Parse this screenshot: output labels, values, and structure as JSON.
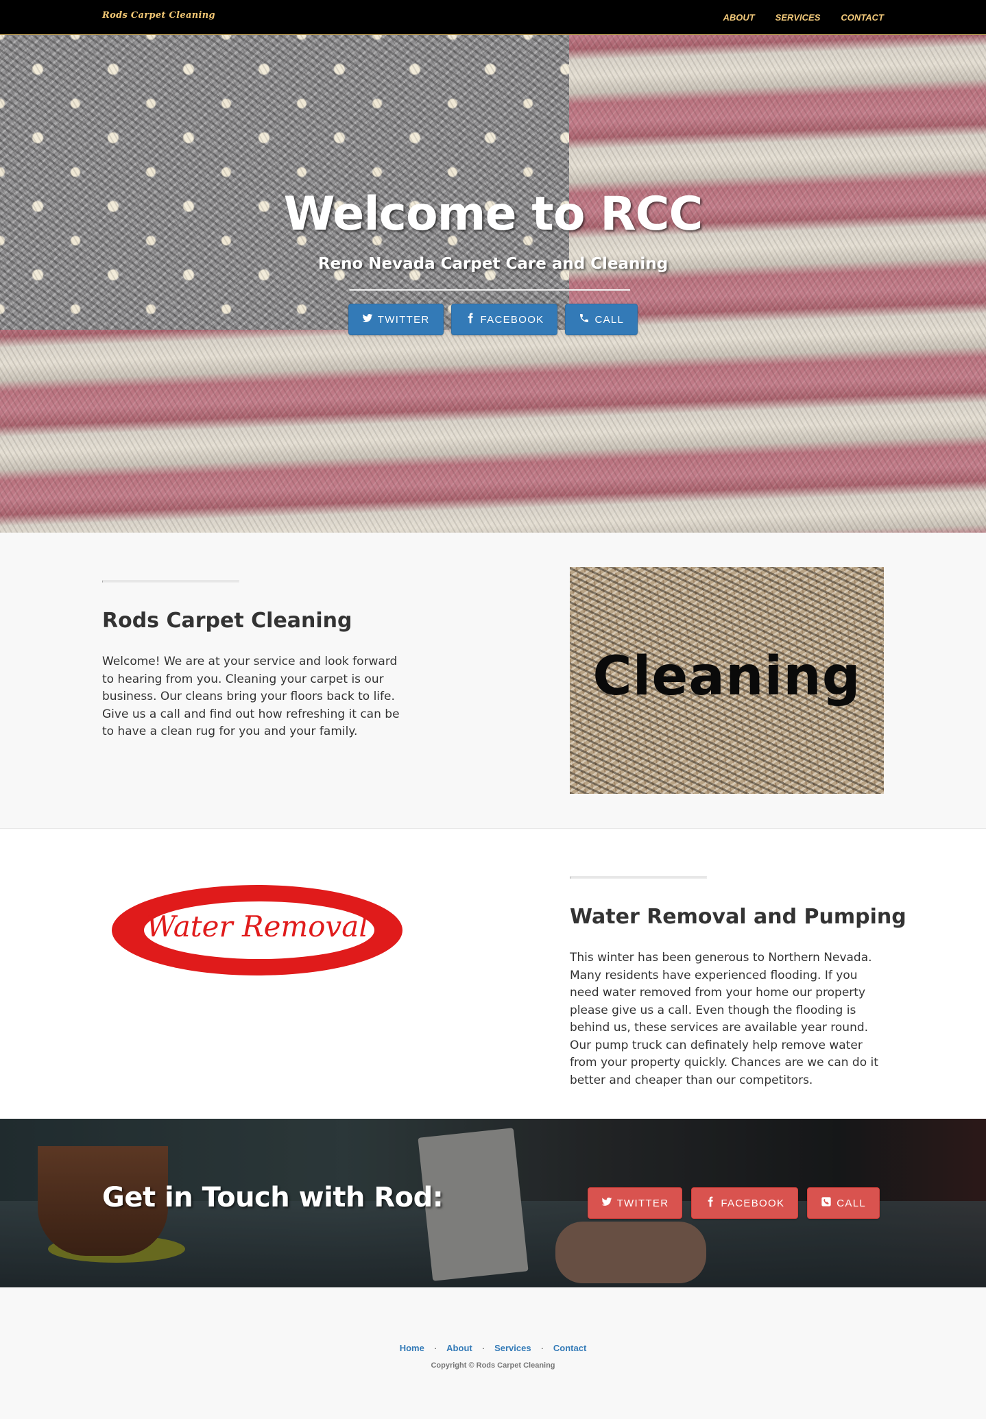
{
  "navbar": {
    "brand": "Rods Carpet Cleaning",
    "links": [
      "About",
      "Services",
      "Contact"
    ]
  },
  "hero": {
    "title": "Welcome to RCC",
    "subtitle": "Reno Nevada Carpet Care and Cleaning",
    "buttons": [
      {
        "label": "Twitter",
        "icon": "twitter-icon"
      },
      {
        "label": "Facebook",
        "icon": "facebook-icon"
      },
      {
        "label": "Call",
        "icon": "phone-icon"
      }
    ]
  },
  "section_cleaning": {
    "heading": "Rods Carpet Cleaning",
    "body": "Welcome! We are at your service and look forward to hearing from you. Cleaning your carpet is our business. Our cleans bring your floors back to life. Give us a call and find out how refreshing it can be to have a clean rug for you and your family.",
    "image_text": "Cleaning"
  },
  "section_water": {
    "heading": "Water Removal and Pumping",
    "body": "This winter has been generous to Northern Nevada. Many residents have experienced flooding. If you need water removed from your home our property please give us a call. Even though the flooding is behind us, these services are available year round. Our pump truck can definately help remove water from your property quickly. Chances are we can do it better and cheaper than our competitors.",
    "image_text": "Water Removal"
  },
  "banner": {
    "title": "Get in Touch with Rod:",
    "buttons": [
      {
        "label": "Twitter",
        "icon": "twitter-icon"
      },
      {
        "label": "Facebook",
        "icon": "facebook-icon"
      },
      {
        "label": "Call",
        "icon": "phone-square-icon"
      }
    ]
  },
  "footer": {
    "links": [
      "Home",
      "About",
      "Services",
      "Contact"
    ],
    "separator": "·",
    "copyright": "Copyright © Rods Carpet Cleaning"
  },
  "colors": {
    "navbar_bg": "#000000",
    "nav_link": "#f2c97a",
    "primary_button": "#337ab7",
    "danger_button": "#d9534f",
    "water_logo_red": "#e01b1b"
  }
}
